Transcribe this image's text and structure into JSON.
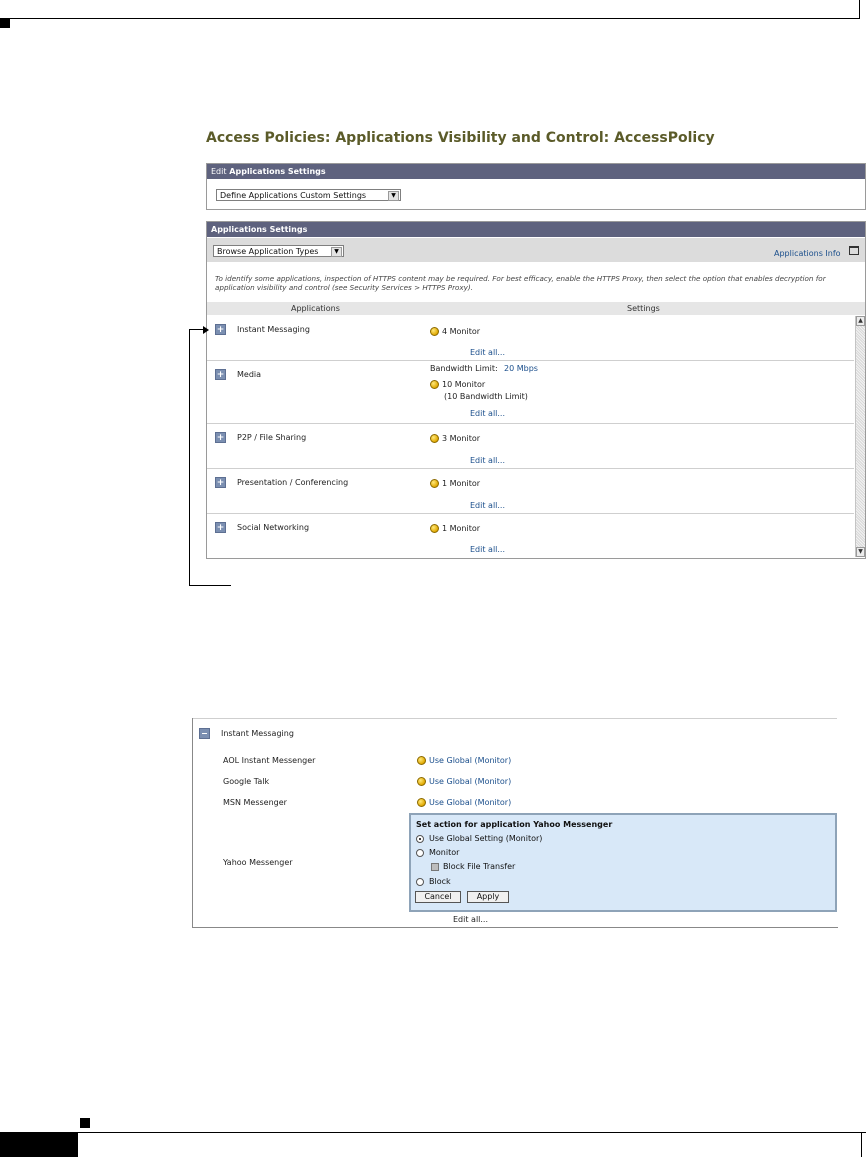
{
  "page": {
    "title": "Access Policies: Applications Visibility and Control: AccessPolicy"
  },
  "edit_panel": {
    "header_prefix": "Edit",
    "header_bold": "Applications Settings",
    "select_value": "Define Applications Custom Settings"
  },
  "apps_panel": {
    "header": "Applications Settings",
    "browse_select": "Browse Application Types",
    "info_link": "Applications Info",
    "note": "To identify some applications, inspection of HTTPS content may be required. For best efficacy, enable the HTTPS Proxy, then select the option that enables decryption for application visibility and control (see Security Services > HTTPS Proxy).",
    "col_applications": "Applications",
    "col_settings": "Settings",
    "rows": [
      {
        "name": "Instant Messaging",
        "setting": "4 Monitor",
        "edit": "Edit all..."
      },
      {
        "name": "Media",
        "bandwidth_label": "Bandwidth Limit:",
        "bandwidth_value": "20 Mbps",
        "setting": "10 Monitor",
        "sub": "(10 Bandwidth Limit)",
        "edit": "Edit all..."
      },
      {
        "name": "P2P / File Sharing",
        "setting": "3 Monitor",
        "edit": "Edit all..."
      },
      {
        "name": "Presentation / Conferencing",
        "setting": "1 Monitor",
        "edit": "Edit all..."
      },
      {
        "name": "Social Networking",
        "setting": "1 Monitor",
        "edit": "Edit all..."
      }
    ]
  },
  "expanded": {
    "category": "Instant Messaging",
    "apps": [
      {
        "name": "AOL Instant Messenger",
        "setting": "Use Global (Monitor)"
      },
      {
        "name": "Google Talk",
        "setting": "Use Global (Monitor)"
      },
      {
        "name": "MSN Messenger",
        "setting": "Use Global (Monitor)"
      },
      {
        "name": "Yahoo Messenger"
      }
    ],
    "popup": {
      "title": "Set action for application Yahoo Messenger",
      "opt_global": "Use Global Setting (Monitor)",
      "opt_monitor": "Monitor",
      "opt_block_file": "Block File Transfer",
      "opt_block": "Block",
      "cancel": "Cancel",
      "apply": "Apply"
    },
    "edit": "Edit all..."
  },
  "colors": {
    "title": "#5b5b29",
    "panel_header": "#5e627e",
    "link": "#1b4f8c",
    "popup_bg": "#d8e8f8"
  }
}
